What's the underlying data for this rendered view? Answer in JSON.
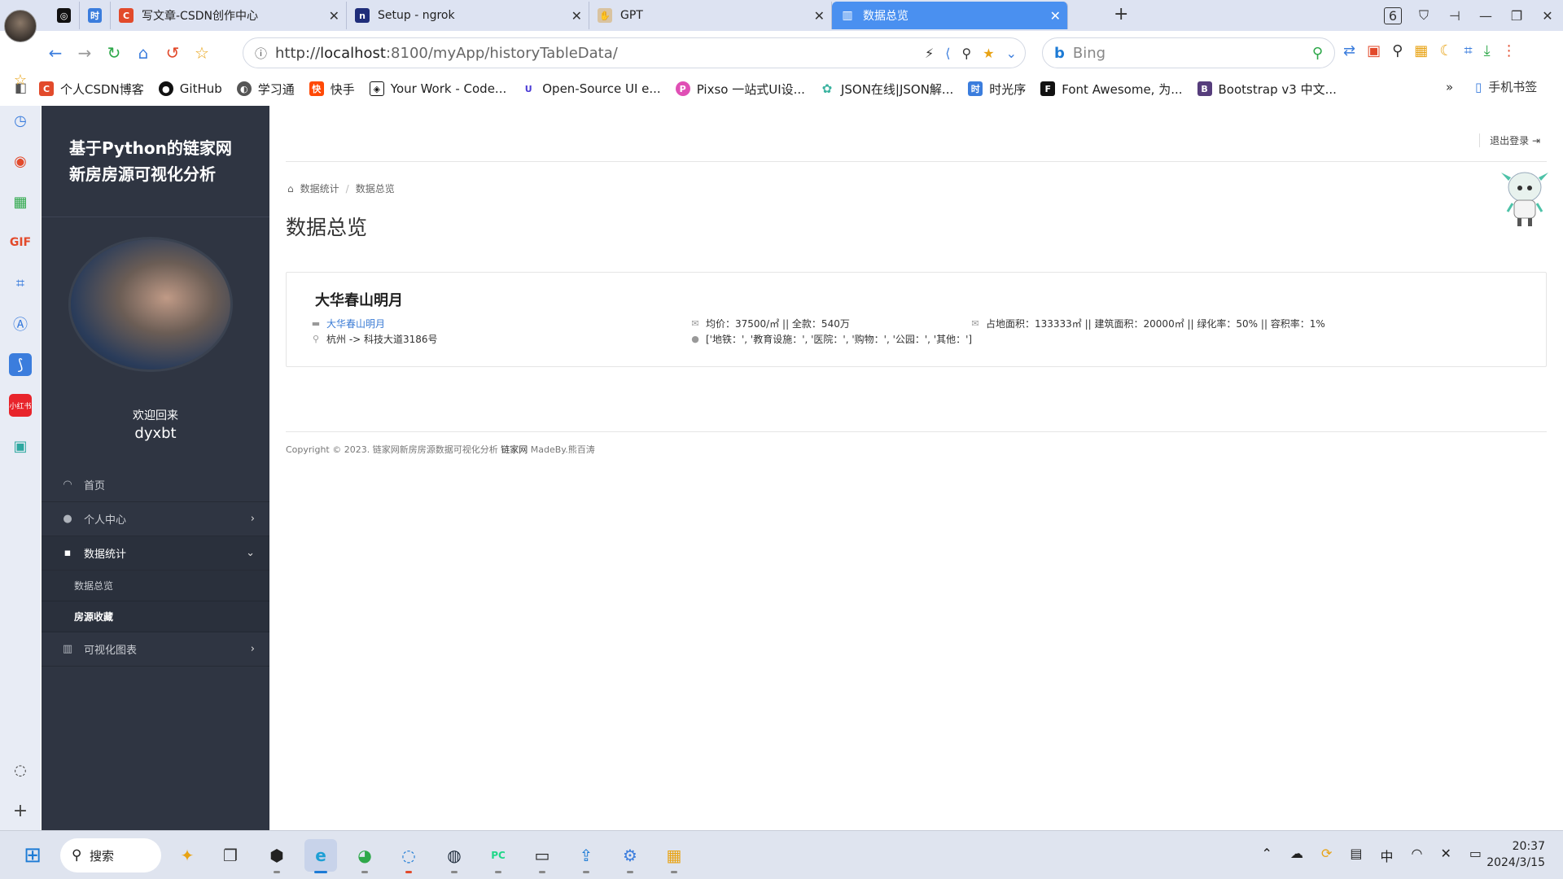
{
  "browser": {
    "tabs": [
      {
        "label": "",
        "icon": "openai-icon",
        "color": "#111111"
      },
      {
        "label": "",
        "icon": "app-icon",
        "color": "#3b7ddd"
      },
      {
        "label": "写文章-CSDN创作中心",
        "icon": "csdn-icon",
        "color": "#e24a2b"
      },
      {
        "label": "Setup - ngrok",
        "icon": "ngrok-icon",
        "color": "#1f2d7a"
      },
      {
        "label": "GPT",
        "icon": "gpt-icon",
        "color": "#c8a36e"
      },
      {
        "label": "数据总览",
        "icon": "map-icon",
        "color": "#ffffff",
        "active": true
      }
    ],
    "tab_count": "6",
    "url_host": "localhost",
    "url_rest": ":8100/myApp/historyTableData/",
    "url_prefix": "http://",
    "search_placeholder": "Bing",
    "bookmarks": [
      {
        "label": "个人CSDN博客",
        "icon": "csdn-icon",
        "color": "#e24a2b",
        "glyph": "C"
      },
      {
        "label": "GitHub",
        "icon": "github-icon",
        "color": "#111111",
        "glyph": "●"
      },
      {
        "label": "学习通",
        "icon": "globe-icon",
        "color": "#555555",
        "glyph": "◐"
      },
      {
        "label": "快手",
        "icon": "kuaishou-icon",
        "color": "#ff4906",
        "glyph": "快"
      },
      {
        "label": "Your Work - Code...",
        "icon": "codepen-icon",
        "color": "#111111",
        "glyph": "◈"
      },
      {
        "label": "Open-Source UI e...",
        "icon": "ui-icon",
        "color": "#4b3bd6",
        "glyph": "U"
      },
      {
        "label": "Pixso 一站式UI设...",
        "icon": "pixso-icon",
        "color": "#e04fb5",
        "glyph": "P"
      },
      {
        "label": "JSON在线|JSON解...",
        "icon": "json-icon",
        "color": "#3bb3a0",
        "glyph": "✿"
      },
      {
        "label": "时光序",
        "icon": "shiguangxu-icon",
        "color": "#3b7ddd",
        "glyph": "时"
      },
      {
        "label": "Font Awesome, 为...",
        "icon": "fontawesome-icon",
        "color": "#111111",
        "glyph": "F"
      },
      {
        "label": "Bootstrap v3 中文...",
        "icon": "bootstrap-icon",
        "color": "#563d7c",
        "glyph": "B"
      }
    ],
    "bookmarks_more": "»",
    "mobile_bookmarks": "手机书签"
  },
  "app": {
    "title_line1": "基于Python的链家网",
    "title_line2": "新房房源可视化分析",
    "welcome": "欢迎回来",
    "username": "dyxbt",
    "menu": {
      "home": "首页",
      "personal": "个人中心",
      "stats": "数据统计",
      "stats_sub": [
        "数据总览",
        "房源收藏"
      ],
      "charts": "可视化图表"
    },
    "logout": "退出登录",
    "breadcrumb": [
      "数据统计",
      "数据总览"
    ],
    "page_title": "数据总览",
    "card": {
      "name": "大华春山明月",
      "link": "大华春山明月",
      "location": "杭州 -> 科技大道3186号",
      "price": "均价：37500/㎡ || 全款：540万",
      "tags": "['地铁：', '教育设施：', '医院：', '购物：', '公园：', '其他：']",
      "area": "占地面积：133333㎡ || 建筑面积：20000㎡ || 绿化率：50% || 容积率：1%"
    },
    "copyright_pre": "Copyright © 2023. 链家网新房房源数据可视化分析 ",
    "copyright_brand": "链家网",
    "copyright_post": " MadeBy.熊百涛"
  },
  "taskbar": {
    "search_label": "搜索",
    "ime": "中",
    "time": "20:37",
    "date": "2024/3/15"
  }
}
